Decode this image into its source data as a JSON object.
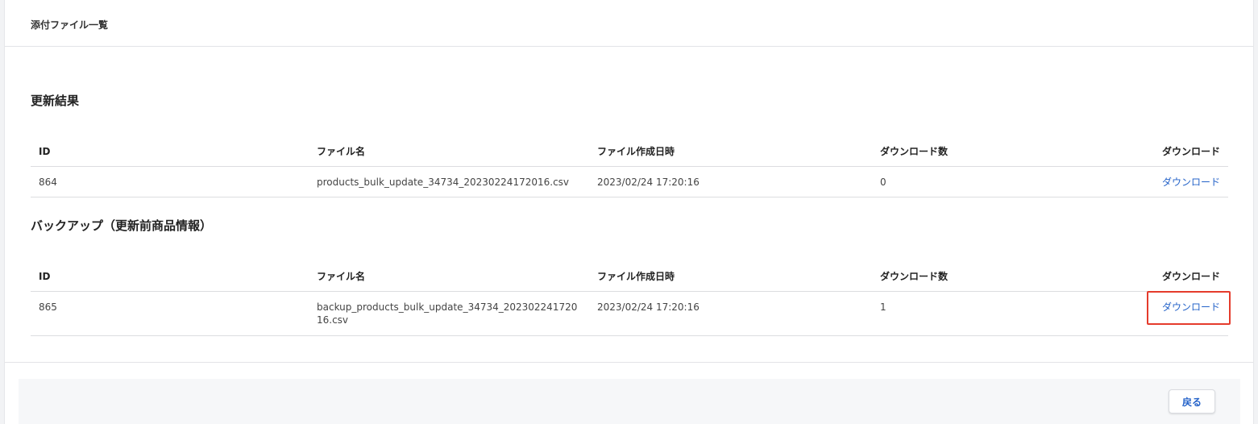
{
  "card": {
    "title": "添付ファイル一覧"
  },
  "columns": {
    "id": "ID",
    "file_name": "ファイル名",
    "created_at": "ファイル作成日時",
    "download_count": "ダウンロード数",
    "download": "ダウンロード"
  },
  "sections": [
    {
      "title": "更新結果",
      "rows": [
        {
          "id": "864",
          "file_name": "products_bulk_update_34734_20230224172016.csv",
          "created_at": "2023/02/24 17:20:16",
          "download_count": "0",
          "download_label": "ダウンロード"
        }
      ]
    },
    {
      "title": "バックアップ（更新前商品情報）",
      "rows": [
        {
          "id": "865",
          "file_name": "backup_products_bulk_update_34734_20230224172016.csv",
          "created_at": "2023/02/24 17:20:16",
          "download_count": "1",
          "download_label": "ダウンロード"
        }
      ]
    }
  ],
  "footer": {
    "back_label": "戻る"
  },
  "colors": {
    "link": "#2563c9",
    "highlight": "#e53b2c"
  }
}
